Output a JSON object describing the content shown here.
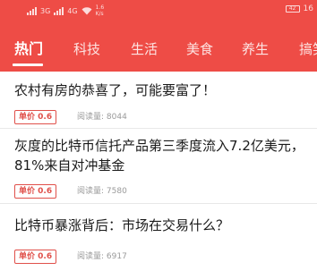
{
  "status_bar": {
    "signal_1": "3G",
    "signal_2": "4G",
    "speed_value": "1.6",
    "speed_unit": "K/s",
    "battery": "42",
    "time": "16"
  },
  "tabs": [
    {
      "label": "热门",
      "active": true
    },
    {
      "label": "科技",
      "active": false
    },
    {
      "label": "生活",
      "active": false
    },
    {
      "label": "美食",
      "active": false
    },
    {
      "label": "养生",
      "active": false
    },
    {
      "label": "搞笑",
      "active": false
    }
  ],
  "articles": [
    {
      "title": "农村有房的恭喜了，可能要富了！",
      "price_label": "单价 0.6",
      "reads": "阅读量: 8044"
    },
    {
      "title": "灰度的比特币信托产品第三季度流入7.2亿美元，81%来自对冲基金",
      "price_label": "单价 0.6",
      "reads": "阅读量: 7580"
    },
    {
      "title": "比特币暴涨背后：市场在交易什么？",
      "price_label": "单价 0.6",
      "reads": "阅读量: 6917"
    }
  ],
  "colors": {
    "accent": "#ee4c46",
    "badge": "#e0504a"
  }
}
